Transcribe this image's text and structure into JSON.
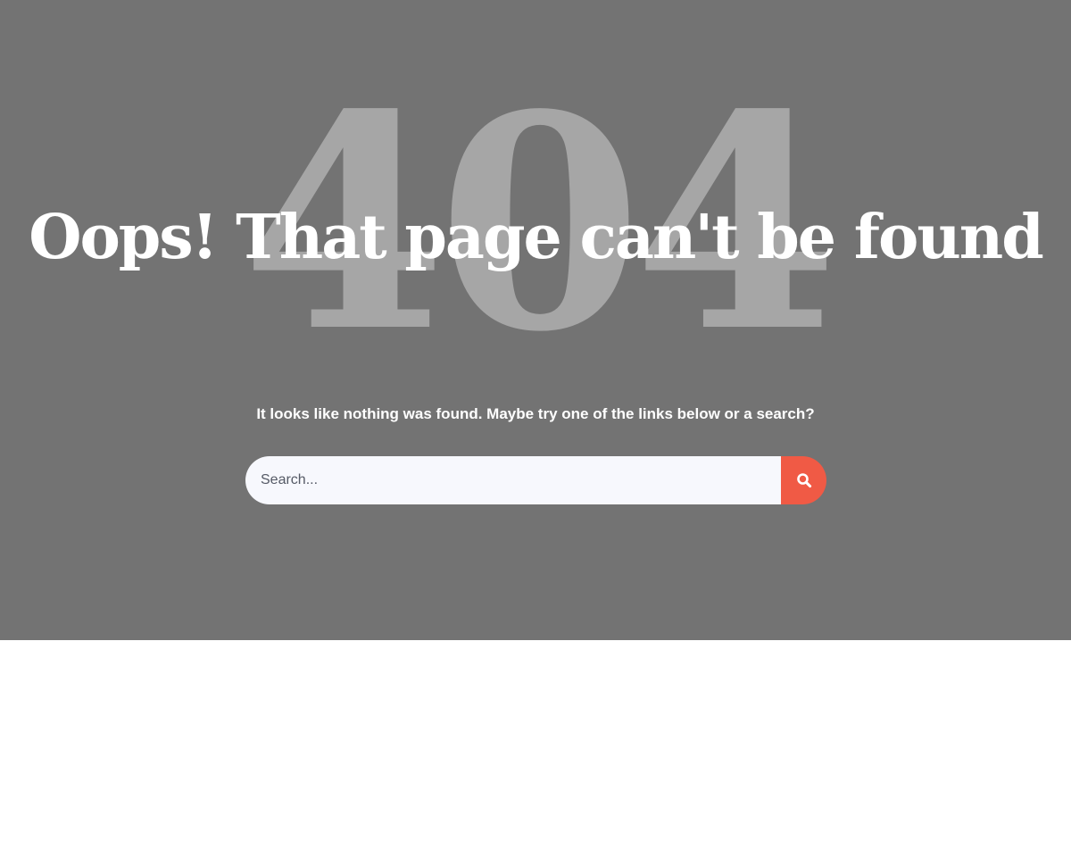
{
  "hero": {
    "background_number": "404",
    "title": "Oops! That page can't be found",
    "message": "It looks like nothing was found. Maybe try one of the links below or a search?"
  },
  "search": {
    "placeholder": "Search...",
    "value": "",
    "button_icon": "search-icon"
  },
  "colors": {
    "hero_background": "#737373",
    "big_number": "#a6a6a6",
    "title_text": "#ffffff",
    "search_field": "#f7f8fd",
    "search_button": "#f05a45",
    "page_background": "#ffffff"
  }
}
